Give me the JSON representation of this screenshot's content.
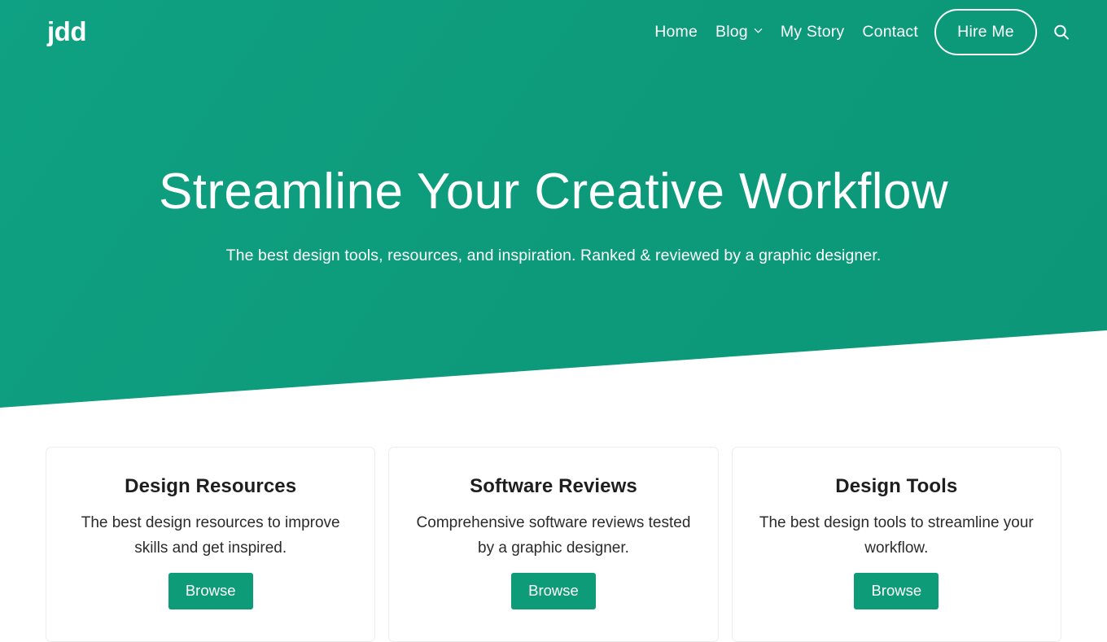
{
  "site": {
    "logo": "jdd",
    "brand_green": "#0d9b78",
    "card_border": "#ededed"
  },
  "header": {
    "nav": [
      {
        "label": "Home",
        "has_dropdown": false,
        "icon": ""
      },
      {
        "label": "Blog",
        "has_dropdown": true,
        "icon": "chevron-down-icon"
      },
      {
        "label": "My Story",
        "has_dropdown": false,
        "icon": ""
      },
      {
        "label": "Contact",
        "has_dropdown": false,
        "icon": ""
      }
    ],
    "cta_label": "Hire Me",
    "search_icon": "search-icon"
  },
  "hero": {
    "title": "Streamline Your Creative Workflow",
    "subtitle": "The best design tools, resources, and inspiration. Ranked & reviewed by a graphic designer."
  },
  "cards": [
    {
      "title": "Design Resources",
      "description": "The best design resources to improve skills and get inspired.",
      "button_label": "Browse"
    },
    {
      "title": "Software Reviews",
      "description": "Comprehensive software reviews tested by a graphic designer.",
      "button_label": "Browse"
    },
    {
      "title": "Design Tools",
      "description": "The best design tools to streamline your workflow.",
      "button_label": "Browse"
    }
  ]
}
